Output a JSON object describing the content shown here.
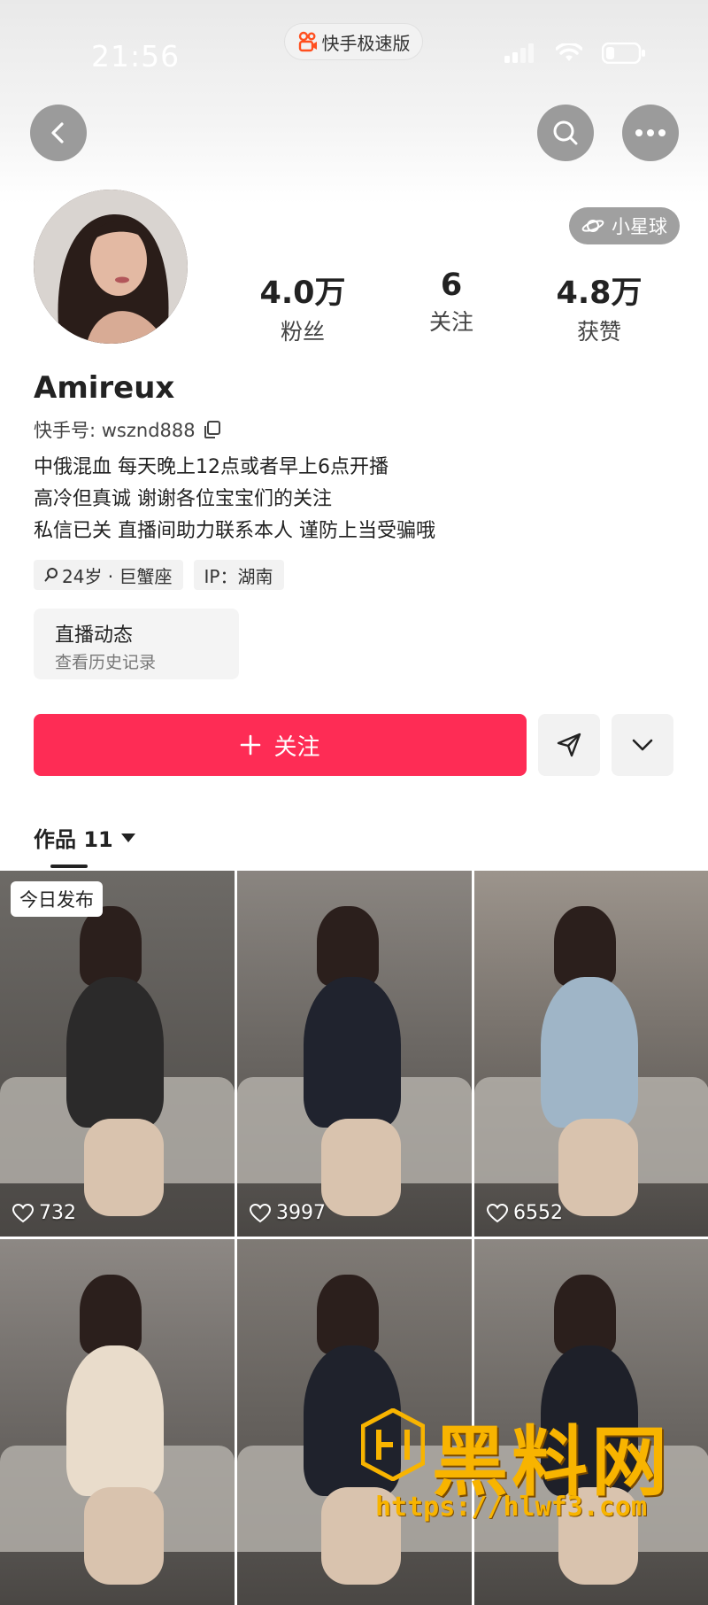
{
  "status_bar": {
    "time": "21:56",
    "app_name": "快手极速版"
  },
  "profile": {
    "badge": "小星球",
    "stats": [
      {
        "value": "4.0万",
        "label": "粉丝"
      },
      {
        "value": "6",
        "label": "关注"
      },
      {
        "value": "4.8万",
        "label": "获赞"
      }
    ],
    "username": "Amireux",
    "kuaishou_id": "快手号: wsznd888",
    "bio": [
      "中俄混血 每天晚上12点或者早上6点开播",
      "高冷但真诚 谢谢各位宝宝们的关注",
      "私信已关 直播间助力联系本人 谨防上当受骗哦"
    ],
    "tags": [
      "24岁 · 巨蟹座",
      "IP：湖南"
    ],
    "live_card": {
      "title": "直播动态",
      "subtitle": "查看历史记录"
    }
  },
  "actions": {
    "follow_label": "关注"
  },
  "works": {
    "tab_label": "作品 11",
    "items": [
      {
        "likes": "732",
        "badge": "今日发布",
        "bg": "#6d6a66",
        "figure": "#2b2a2a"
      },
      {
        "likes": "3997",
        "badge": "",
        "bg": "#8a8580",
        "figure": "#20232e"
      },
      {
        "likes": "6552",
        "badge": "",
        "bg": "#9c948c",
        "figure": "#9fb5c7"
      },
      {
        "likes": "",
        "badge": "",
        "bg": "#8d8884",
        "figure": "#e9dccb"
      },
      {
        "likes": "",
        "badge": "",
        "bg": "#7f7a75",
        "figure": "#1f222c"
      },
      {
        "likes": "",
        "badge": "",
        "bg": "#8c8782",
        "figure": "#1e2029"
      }
    ]
  },
  "watermark": {
    "text": "黑料网",
    "url": "https://hlwf3.com"
  },
  "colors": {
    "follow": "#fe2c55",
    "watermark": "#f8b400"
  }
}
